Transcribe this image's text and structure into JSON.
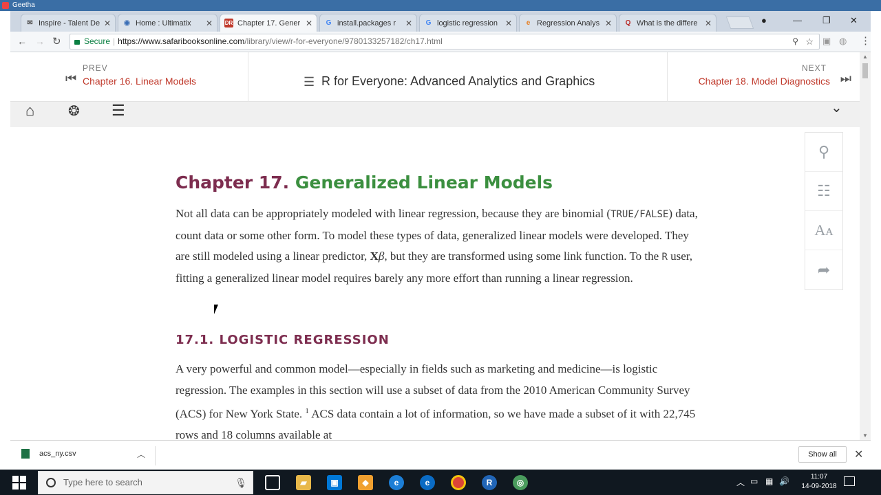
{
  "window": {
    "title": "Geetha"
  },
  "tabs": [
    {
      "label": "Inspire - Talent De",
      "icon": "mail-icon"
    },
    {
      "label": "Home : Ultimatix",
      "icon": "tcs-icon"
    },
    {
      "label": "Chapter 17. Gener",
      "icon": "safari-books-icon",
      "active": true
    },
    {
      "label": "install.packages r",
      "icon": "google-icon"
    },
    {
      "label": "logistic regression",
      "icon": "google-icon"
    },
    {
      "label": "Regression Analys",
      "icon": "edureka-icon"
    },
    {
      "label": "What is the differe",
      "icon": "quora-icon"
    }
  ],
  "address": {
    "secure_label": "Secure",
    "url_scheme_host": "https://www.safaribooksonline.com",
    "url_path": "/library/view/r-for-everyone/9780133257182/ch17.html"
  },
  "chapter_nav": {
    "prev_small": "PREV",
    "prev_link": "Chapter 16. Linear Models",
    "book_title": "R for Everyone: Advanced Analytics and Graphics",
    "next_small": "NEXT",
    "next_link": "Chapter 18. Model Diagnostics"
  },
  "article": {
    "chapter_num": "Chapter 17.",
    "chapter_name": "Generalized Linear Models",
    "p1_a": "Not all data can be appropriately modeled with linear regression, because they are binomial (",
    "p1_code": "TRUE/FALSE",
    "p1_b": ") data, count data or some other form. To model these types of data, generalized linear models were developed. They are still modeled using a linear predictor,",
    "p1_math_X": "X",
    "p1_math_beta": "β",
    "p1_c": ", but they are transformed using some link function. To the",
    "p1_code2": "R",
    "p1_d": "user, fitting a generalized linear model requires barely any more effort than running a linear regression.",
    "section_title": "17.1. LOGISTIC REGRESSION",
    "p2_a": "A very powerful and common model—especially in fields such as marketing and medicine—is logistic regression. The examples in this section will use a subset of data from the 2010 American Community Survey (ACS) for New York State.",
    "p2_sup": "1",
    "p2_b": " ACS data contain a lot of information, so we have made a subset of it with 22,745 rows and 18 columns available at"
  },
  "downloads": {
    "file": "acs_ny.csv",
    "show_all": "Show all"
  },
  "taskbar": {
    "search_placeholder": "Type here to search",
    "time": "11:07",
    "date": "14-09-2018"
  },
  "colors": {
    "chapter_num": "#7d2d4f",
    "chapter_name": "#3b8f3f",
    "nav_link": "#c0392b"
  }
}
